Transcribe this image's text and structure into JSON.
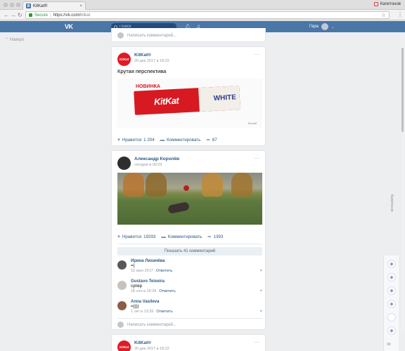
{
  "browser": {
    "tab_title": "KitKat®",
    "tab_close": "×",
    "profile_name": "Капитонов",
    "secure_label": "Secure",
    "url_host": "https://vk.com/",
    "url_path": "kitkat"
  },
  "vk": {
    "logo": "VK",
    "search_placeholder": "Поиск",
    "user_name": "Гера",
    "back_up": "Наверх"
  },
  "feed": {
    "write_comment_placeholder": "Написать комментарий...",
    "post1": {
      "author": "KitKat®",
      "date": "20 дек 2017 в 18:22",
      "text": "Крутая перспектива",
      "promo_new": "НОВИНКА",
      "promo_brand": "KitKat",
      "promo_variant": "WHITE",
      "promo_footnote": "Белый",
      "likes_label": "Нравится",
      "likes": "1 204",
      "comment_label": "Комментировать",
      "shares": "67"
    },
    "post2": {
      "author": "Александр Королёв",
      "date": "сегодня в 00:03",
      "likes_label": "Нравится",
      "likes": "19293",
      "comment_label": "Комментировать",
      "shares": "1393",
      "show_comments": "Показать 41 комментарий",
      "comments": [
        {
          "name": "Ирина Лихачёва",
          "text": "=)",
          "date": "10 июл 2017",
          "reply": "Ответить"
        },
        {
          "name": "Gustavo Teixeira",
          "text": "супер",
          "date": "18 сен в 19:39",
          "reply": "Ответить"
        },
        {
          "name": "Anna Vasileva",
          "text": "=))))",
          "date": "1 окт в 13:35",
          "reply": "Ответить"
        }
      ]
    },
    "post3": {
      "author": "KitKat®",
      "date": "20 дек 2017 в 18:22"
    }
  },
  "sidebar_right": {
    "count": "99",
    "vertical_label": "Капитонов"
  }
}
